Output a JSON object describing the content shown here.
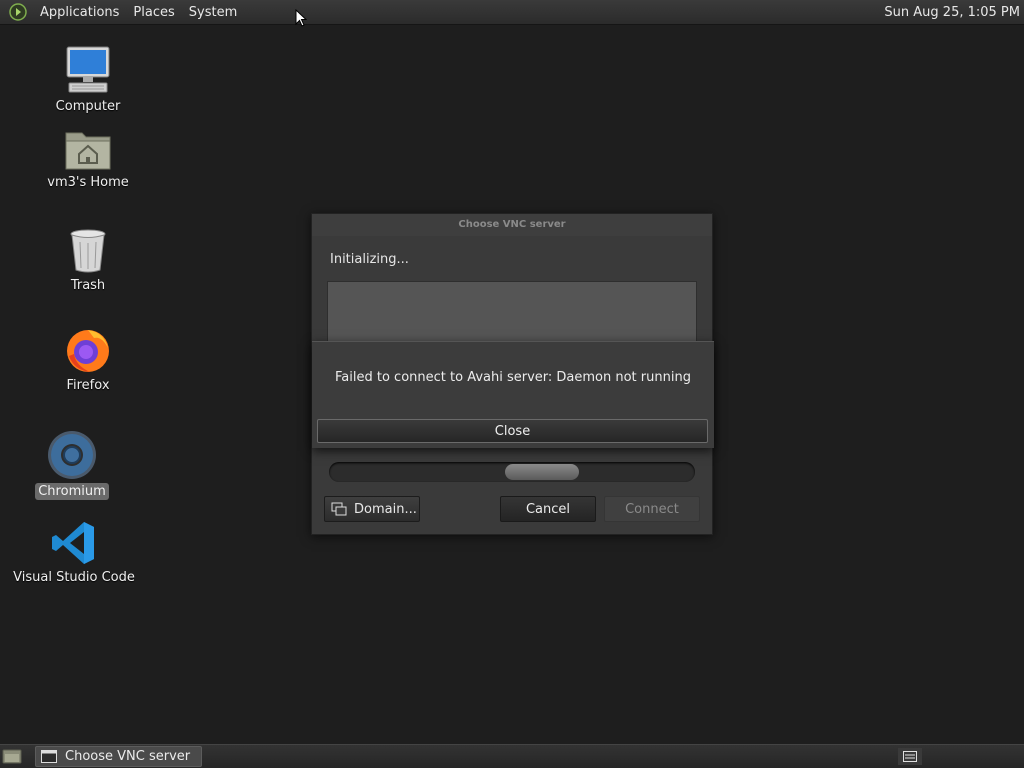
{
  "top_panel": {
    "menus": [
      "Applications",
      "Places",
      "System"
    ],
    "clock": "Sun Aug 25,  1:05 PM"
  },
  "desktop_icons": [
    {
      "label": "Computer",
      "icon": "computer-icon"
    },
    {
      "label": "vm3's Home",
      "icon": "home-folder-icon"
    },
    {
      "label": "Trash",
      "icon": "trash-icon"
    },
    {
      "label": "Firefox",
      "icon": "firefox-icon"
    },
    {
      "label": "Chromium",
      "icon": "chromium-icon",
      "selected": true
    },
    {
      "label": "Visual Studio Code",
      "icon": "vscode-icon"
    }
  ],
  "vnc_dialog": {
    "title": "Choose VNC server",
    "status": "Initializing...",
    "domain_button": "Domain...",
    "cancel_button": "Cancel",
    "connect_button": "Connect",
    "connect_enabled": false
  },
  "error_dialog": {
    "message": "Failed to connect to Avahi server: Daemon not running",
    "close_button": "Close"
  },
  "taskbar": {
    "tasks": [
      {
        "label": "Choose VNC server",
        "icon": "window-icon"
      }
    ]
  }
}
